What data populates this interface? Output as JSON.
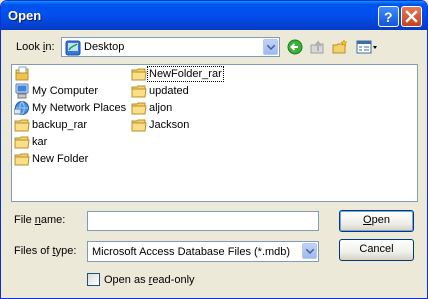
{
  "window": {
    "title": "Open"
  },
  "lookin": {
    "label_pre": "Look ",
    "label_ul": "i",
    "label_post": "n:",
    "value": "Desktop"
  },
  "items": [
    {
      "label": "",
      "icon": "documents-icon"
    },
    {
      "label": "My Computer",
      "icon": "computer-icon"
    },
    {
      "label": "My Network Places",
      "icon": "network-icon"
    },
    {
      "label": "backup_rar",
      "icon": "folder-icon"
    },
    {
      "label": "kar",
      "icon": "folder-icon"
    },
    {
      "label": "New Folder",
      "icon": "folder-icon"
    },
    {
      "label": "NewFolder_rar",
      "icon": "folder-icon"
    },
    {
      "label": "updated",
      "icon": "folder-icon"
    },
    {
      "label": "aljon",
      "icon": "folder-icon"
    },
    {
      "label": "Jackson",
      "icon": "folder-icon"
    }
  ],
  "filename": {
    "label_pre": "File ",
    "label_ul": "n",
    "label_post": "ame:",
    "value": ""
  },
  "filetype": {
    "label_pre": "Files of ",
    "label_ul": "t",
    "label_post": "ype:",
    "value": "Microsoft Access Database Files (*.mdb)"
  },
  "buttons": {
    "open_ul": "O",
    "open_rest": "pen",
    "cancel": "Cancel"
  },
  "readonly": {
    "label_pre": "Open as ",
    "label_ul": "r",
    "label_post": "ead-only",
    "checked": false
  }
}
